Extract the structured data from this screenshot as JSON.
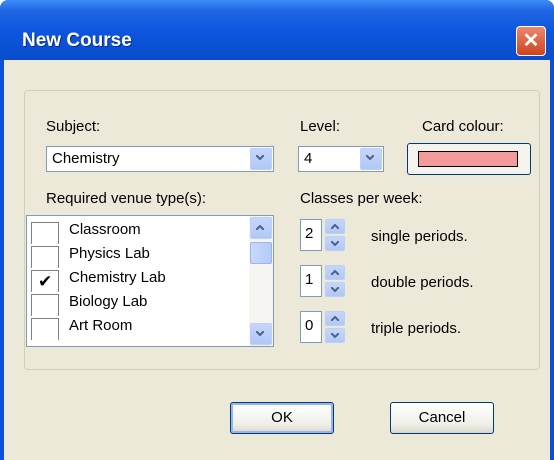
{
  "window": {
    "title": "New Course",
    "close_glyph": "✕"
  },
  "subject": {
    "label": "Subject:",
    "value": "Chemistry"
  },
  "level": {
    "label": "Level:",
    "value": "4"
  },
  "card_colour": {
    "label": "Card colour:",
    "color": "#f39a9a"
  },
  "venues": {
    "label": "Required venue type(s):",
    "items": [
      {
        "label": "Classroom",
        "checked": false
      },
      {
        "label": "Physics Lab",
        "checked": false
      },
      {
        "label": "Chemistry Lab",
        "checked": true
      },
      {
        "label": "Biology Lab",
        "checked": false
      },
      {
        "label": "Art Room",
        "checked": false
      }
    ]
  },
  "classes": {
    "label": "Classes per week:",
    "rows": [
      {
        "value": "2",
        "suffix": "single periods."
      },
      {
        "value": "1",
        "suffix": "double periods."
      },
      {
        "value": "0",
        "suffix": "triple periods."
      }
    ]
  },
  "buttons": {
    "ok": "OK",
    "cancel": "Cancel"
  },
  "colors": {
    "title_bar": "#0c55dc",
    "dialog_bg": "#ece9d8",
    "close_red": "#cf4220"
  }
}
